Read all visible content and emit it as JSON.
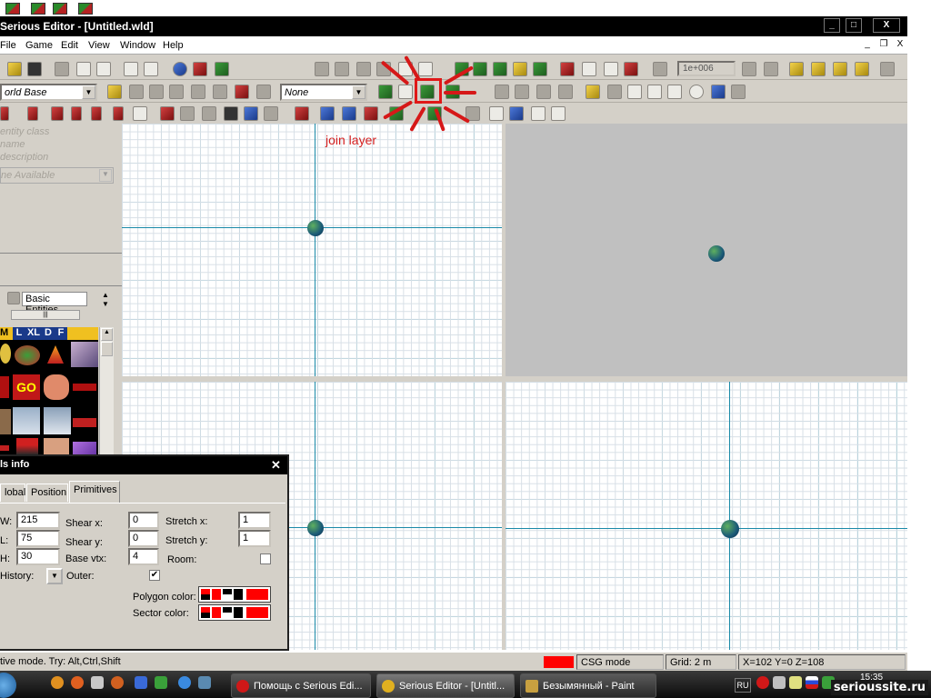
{
  "window": {
    "title": "Serious Editor - [Untitled.wld]",
    "minimize": "_",
    "maximize": "□",
    "close": "X"
  },
  "menu": {
    "items": [
      "File",
      "Game",
      "Edit",
      "View",
      "Window",
      "Help"
    ],
    "mdi_min": "_",
    "mdi_restore": "❐",
    "mdi_close": "X"
  },
  "toolbar": {
    "world_combo": "orld Base",
    "layer_combo": "None",
    "scale_value": "1e+006"
  },
  "left_panel": {
    "entity_class": "entity class",
    "name": "name",
    "description": "description",
    "none_available": "ne Available",
    "browser_title": "Basic Entities",
    "size_tabs": [
      "M",
      "L",
      "XL",
      "D",
      "F"
    ]
  },
  "annotation": {
    "text": "join layer",
    "color": "#d42020"
  },
  "dialog": {
    "title": "ls info",
    "tabs": [
      "lobal",
      "Position",
      "Primitives"
    ],
    "fields": {
      "w_label": "W:",
      "w_value": "215",
      "l_label": "L:",
      "l_value": "75",
      "h_label": "H:",
      "h_value": "30",
      "shear_x_label": "Shear x:",
      "shear_x_value": "0",
      "shear_y_label": "Shear y:",
      "shear_y_value": "0",
      "base_vtx_label": "Base vtx:",
      "base_vtx_value": "4",
      "stretch_x_label": "Stretch x:",
      "stretch_x_value": "1",
      "stretch_y_label": "Stretch y:",
      "stretch_y_value": "1",
      "room_label": "Room:",
      "history_label": "History:",
      "outer_label": "Outer:",
      "outer_checked": "✔",
      "polygon_color_label": "Polygon color:",
      "sector_color_label": "Sector color:"
    }
  },
  "status": {
    "hint": "tive mode. Try: Alt,Ctrl,Shift",
    "mode": "CSG mode",
    "grid": "Grid: 2 m",
    "coords": "X=102 Y=0 Z=108",
    "mode_color": "#ff0000"
  },
  "taskbar": {
    "tasks": [
      "Помощь с Serious Edi...",
      "Serious Editor - [Untitl...",
      "Безымянный - Paint"
    ],
    "lang": "RU",
    "clock": "15:35"
  },
  "watermark": "serioussite.ru"
}
